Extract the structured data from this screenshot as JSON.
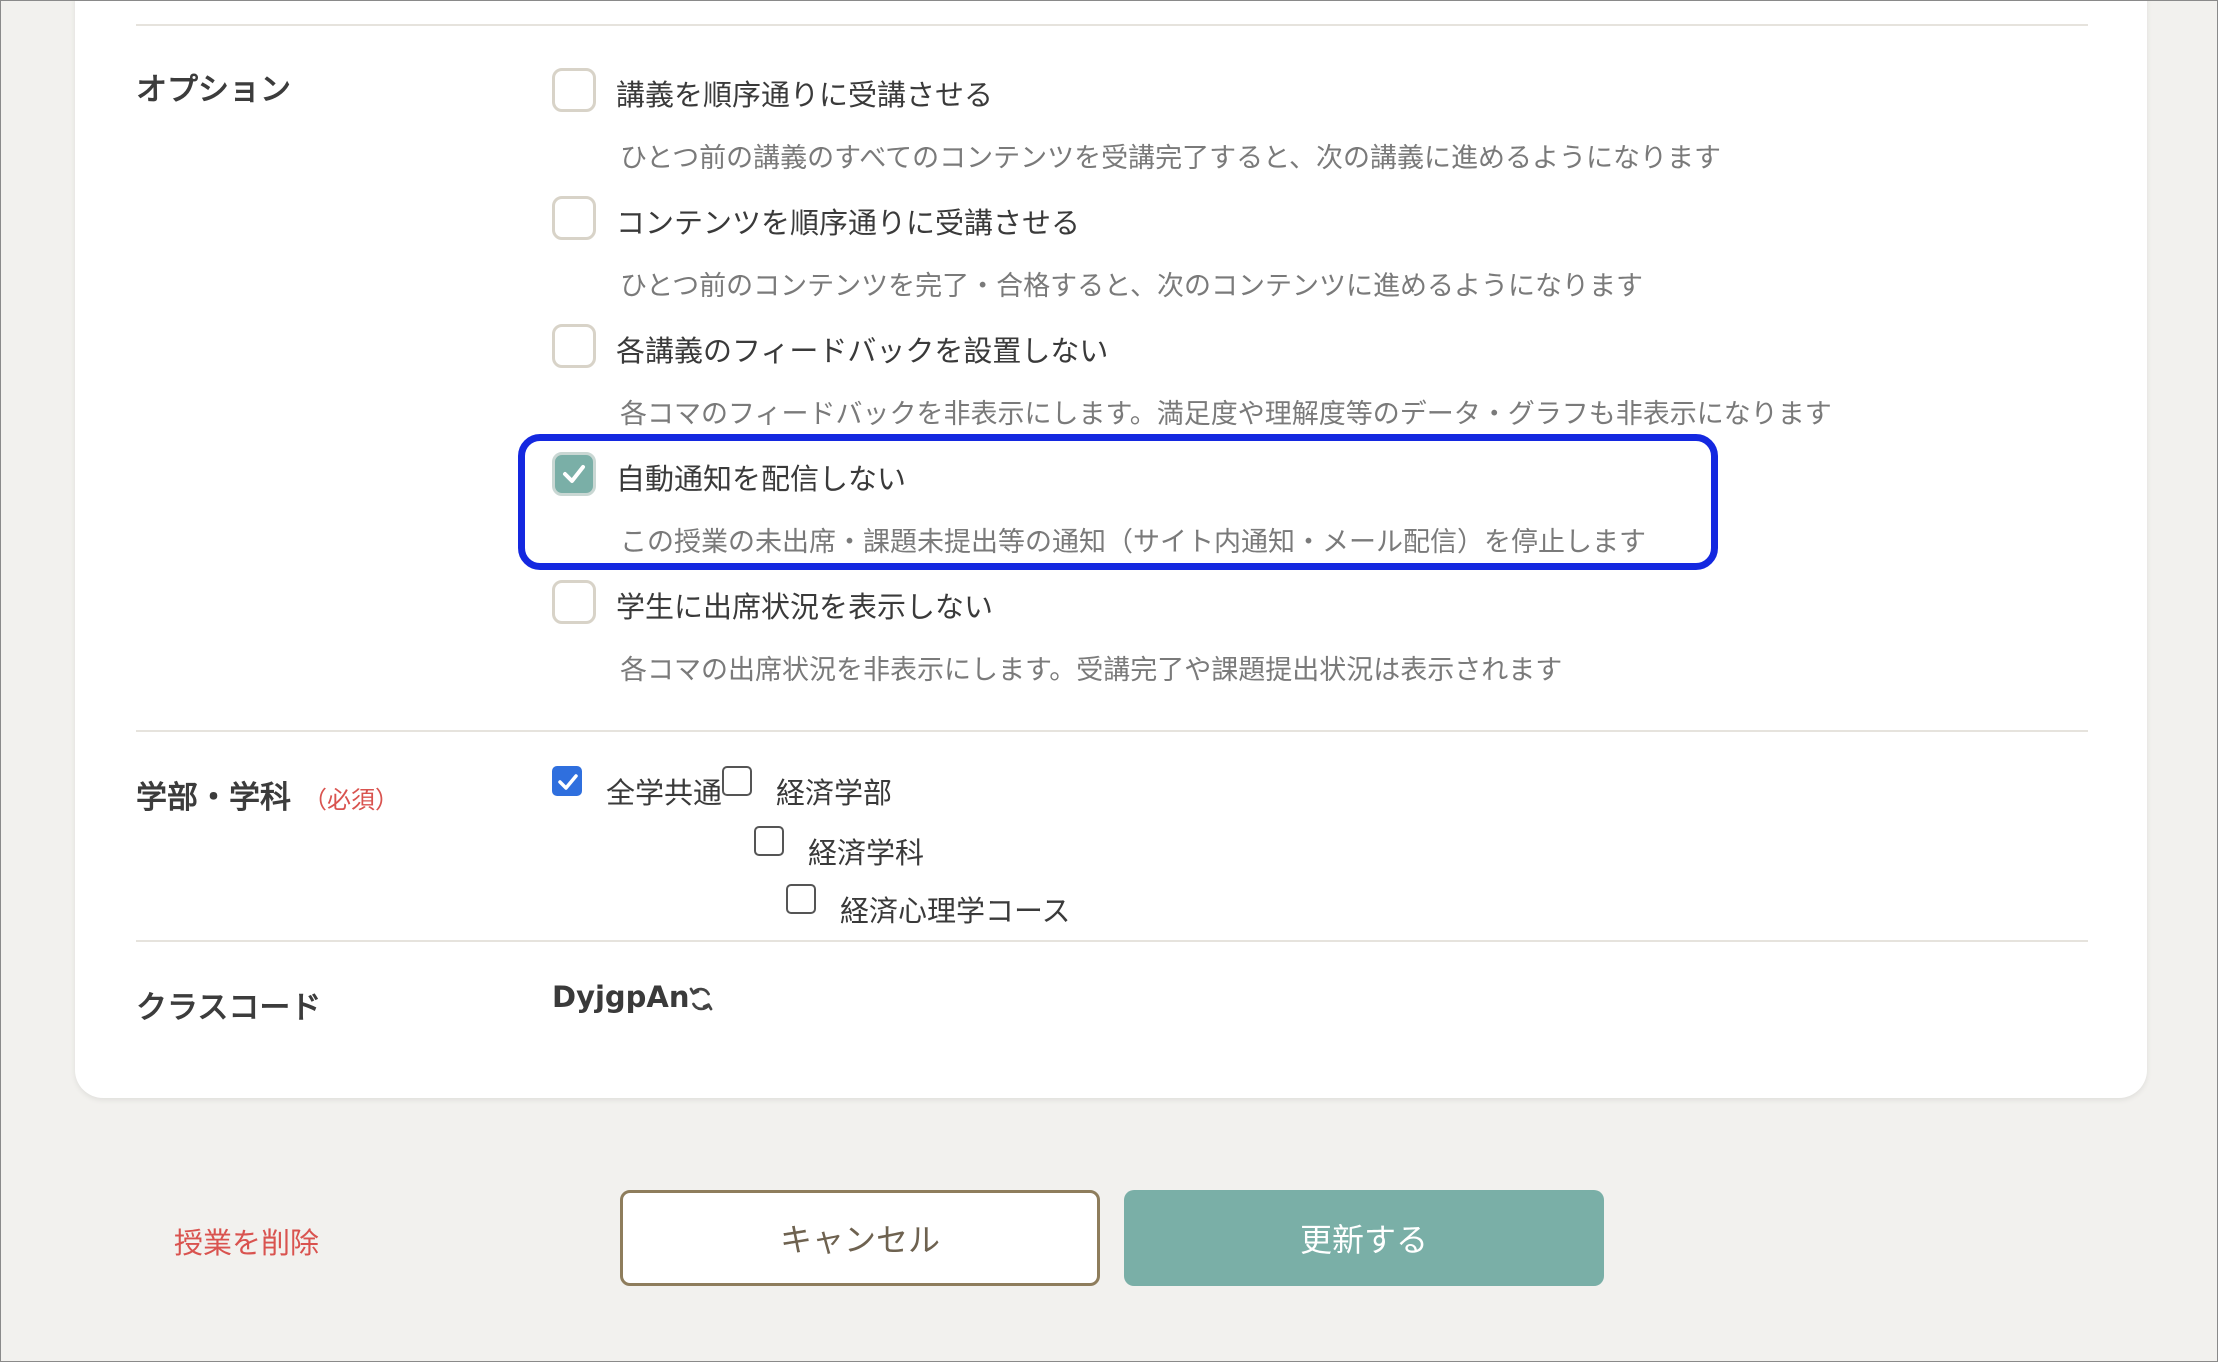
{
  "options": {
    "label": "オプション",
    "items": [
      {
        "label": "講義を順序通りに受講させる",
        "desc": "ひとつ前の講義のすべてのコンテンツを受講完了すると、次の講義に進めるようになります",
        "checked": false
      },
      {
        "label": "コンテンツを順序通りに受講させる",
        "desc": "ひとつ前のコンテンツを完了・合格すると、次のコンテンツに進めるようになります",
        "checked": false
      },
      {
        "label": "各講義のフィードバックを設置しない",
        "desc": "各コマのフィードバックを非表示にします。満足度や理解度等のデータ・グラフも非表示になります",
        "checked": false
      },
      {
        "label": "自動通知を配信しない",
        "desc": "この授業の未出席・課題未提出等の通知（サイト内通知・メール配信）を停止します",
        "checked": true
      },
      {
        "label": "学生に出席状況を表示しない",
        "desc": "各コマの出席状況を非表示にします。受講完了や課題提出状況は表示されます",
        "checked": false
      }
    ]
  },
  "department": {
    "label": "学部・学科",
    "required": "（必須）",
    "items": [
      {
        "label": "全学共通",
        "checked": true
      },
      {
        "label": "経済学部",
        "checked": false
      },
      {
        "label": "経済学科",
        "checked": false
      },
      {
        "label": "経済心理学コース",
        "checked": false
      }
    ]
  },
  "class_code": {
    "label": "クラスコード",
    "value": "DyjgpAn",
    "refresh_icon": "refresh-icon"
  },
  "actions": {
    "delete": "授業を削除",
    "cancel": "キャンセル",
    "update": "更新する"
  },
  "colors": {
    "accent": "#7aafa7",
    "highlight": "#1428e0",
    "danger": "#d9534f",
    "checkbox_blue": "#2f6fde"
  }
}
